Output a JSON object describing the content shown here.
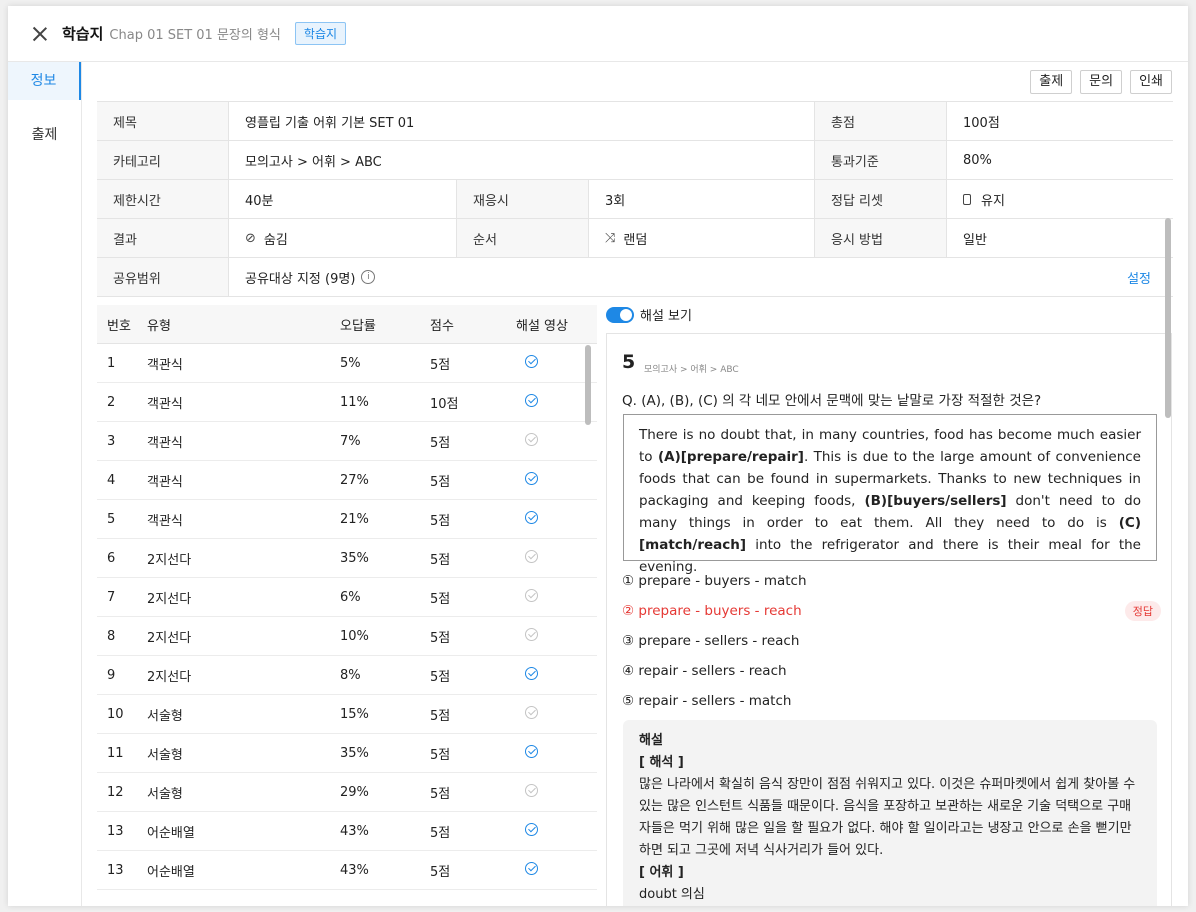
{
  "header": {
    "title": "학습지",
    "subtitle": "Chap 01 SET 01 문장의 형식",
    "badge": "학습지"
  },
  "sidebar": {
    "items": [
      {
        "label": "정보",
        "active": true
      },
      {
        "label": "출제",
        "active": false
      }
    ]
  },
  "toolbar": {
    "buttons": [
      "출제",
      "문의",
      "인쇄"
    ]
  },
  "info": {
    "title_label": "제목",
    "title_value": "영플립 기출 어휘 기본 SET 01",
    "total_label": "총점",
    "total_value": "100점",
    "category_label": "카테고리",
    "category_value": "모의고사 > 어휘 > ABC",
    "pass_label": "통과기준",
    "pass_value": "80%",
    "time_label": "제한시간",
    "time_value": "40분",
    "retry_label": "재응시",
    "retry_value": "3회",
    "reset_label": "정답 리셋",
    "reset_value": "유지",
    "result_label": "결과",
    "result_value": "숨김",
    "order_label": "순서",
    "order_value": "랜덤",
    "method_label": "응시 방법",
    "method_value": "일반",
    "share_label": "공유범위",
    "share_value": "공유대상 지정 (9명)",
    "share_link": "설정"
  },
  "questions": {
    "headers": [
      "번호",
      "유형",
      "오답률",
      "점수",
      "해설 영상"
    ],
    "rows": [
      {
        "no": "1",
        "type": "객관식",
        "wrong": "5%",
        "score": "5점",
        "video": true
      },
      {
        "no": "2",
        "type": "객관식",
        "wrong": "11%",
        "score": "10점",
        "video": true
      },
      {
        "no": "3",
        "type": "객관식",
        "wrong": "7%",
        "score": "5점",
        "video": false
      },
      {
        "no": "4",
        "type": "객관식",
        "wrong": "27%",
        "score": "5점",
        "video": true
      },
      {
        "no": "5",
        "type": "객관식",
        "wrong": "21%",
        "score": "5점",
        "video": true
      },
      {
        "no": "6",
        "type": "2지선다",
        "wrong": "35%",
        "score": "5점",
        "video": false
      },
      {
        "no": "7",
        "type": "2지선다",
        "wrong": "6%",
        "score": "5점",
        "video": false
      },
      {
        "no": "8",
        "type": "2지선다",
        "wrong": "10%",
        "score": "5점",
        "video": false
      },
      {
        "no": "9",
        "type": "2지선다",
        "wrong": "8%",
        "score": "5점",
        "video": true
      },
      {
        "no": "10",
        "type": "서술형",
        "wrong": "15%",
        "score": "5점",
        "video": false
      },
      {
        "no": "11",
        "type": "서술형",
        "wrong": "35%",
        "score": "5점",
        "video": true
      },
      {
        "no": "12",
        "type": "서술형",
        "wrong": "29%",
        "score": "5점",
        "video": false
      },
      {
        "no": "13",
        "type": "어순배열",
        "wrong": "43%",
        "score": "5점",
        "video": true
      },
      {
        "no": "13",
        "type": "어순배열",
        "wrong": "43%",
        "score": "5점",
        "video": true
      }
    ]
  },
  "detail": {
    "toggle_label": "해설 보기",
    "toggle_on": true,
    "number": "5",
    "path": "모의고사 > 어휘 > ABC",
    "question": "Q. (A), (B), (C) 의 각 네모 안에서 문맥에 맞는 낱말로 가장 적절한 것은?",
    "passage": {
      "p1": "There is no doubt that, in many countries, food has become much easier to ",
      "a": "(A)[prepare/repair]",
      "p2": ". This is due to the large amount of convenience foods that can be found in supermarkets. Thanks to new techniques in packaging and keeping foods, ",
      "b": "(B)[buyers/sellers]",
      "p3": " don't need to do many things in order to eat them. All they need to do is ",
      "c": "(C)[match/reach]",
      "p4": " into the refrigerator and there is their meal for the evening."
    },
    "options": [
      {
        "text": "① prepare - buyers - match",
        "correct": false
      },
      {
        "text": "② prepare - buyers - reach",
        "correct": true
      },
      {
        "text": "③ prepare - sellers - reach",
        "correct": false
      },
      {
        "text": "④ repair - sellers - reach",
        "correct": false
      },
      {
        "text": "⑤ repair - sellers - match",
        "correct": false
      }
    ],
    "answer_badge": "정답",
    "explanation": {
      "title": "해설",
      "translation_head": "[ 해석 ]",
      "translation": "많은 나라에서 확실히 음식 장만이 점점 쉬워지고 있다. 이것은 슈퍼마켓에서 쉽게 찾아볼 수 있는 많은 인스턴트 식품들 때문이다. 음식을 포장하고 보관하는 새로운 기술 덕택으로 구매자들은 먹기 위해 많은 일을 할 필요가 없다. 해야 할 일이라고는 냉장고 안으로 손을 뻗기만 하면 되고 그곳에 저녁 식사거리가 들어 있다.",
      "vocab_head": "[ 어휘 ]",
      "vocab": "doubt 의심"
    }
  },
  "colors": {
    "accent": "#1e88e5",
    "correct": "#e53935"
  }
}
